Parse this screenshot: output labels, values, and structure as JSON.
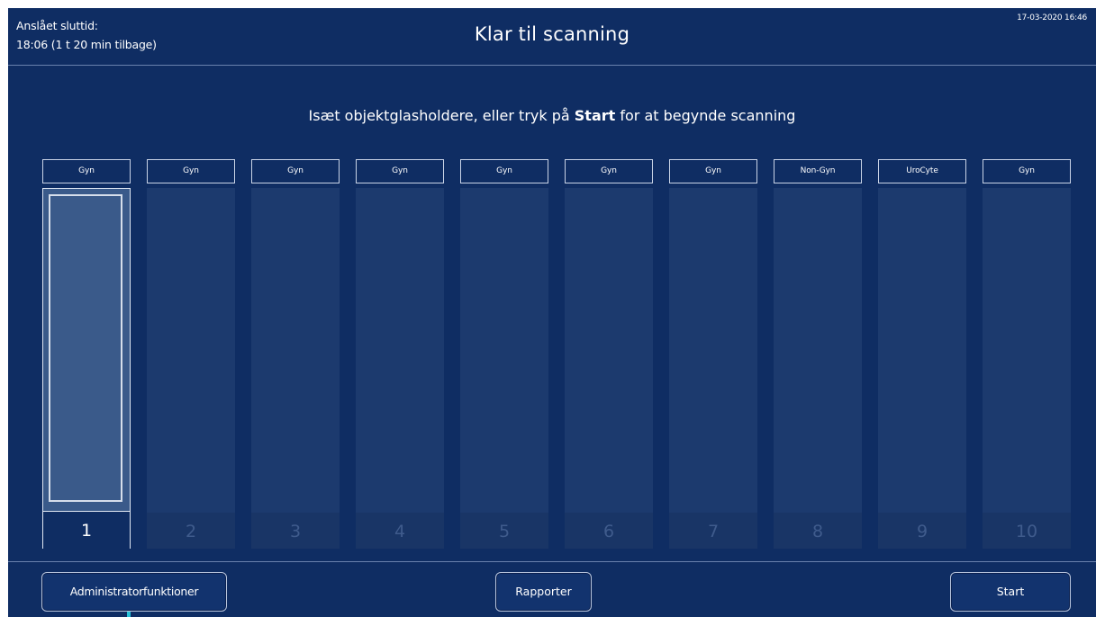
{
  "header": {
    "eta_label": "Anslået sluttid:",
    "eta_value": "18:06 (1 t 20 min tilbage)",
    "title": "Klar til scanning",
    "datetime": "17-03-2020 16:46"
  },
  "instruction": {
    "before": "Isæt objektglasholdere, eller tryk på ",
    "bold": "Start",
    "after": " for at begynde scanning"
  },
  "slots": [
    {
      "label": "Gyn",
      "number": "1",
      "loaded": true
    },
    {
      "label": "Gyn",
      "number": "2",
      "loaded": false
    },
    {
      "label": "Gyn",
      "number": "3",
      "loaded": false
    },
    {
      "label": "Gyn",
      "number": "4",
      "loaded": false
    },
    {
      "label": "Gyn",
      "number": "5",
      "loaded": false
    },
    {
      "label": "Gyn",
      "number": "6",
      "loaded": false
    },
    {
      "label": "Gyn",
      "number": "7",
      "loaded": false
    },
    {
      "label": "Non-Gyn",
      "number": "8",
      "loaded": false
    },
    {
      "label": "UroCyte",
      "number": "9",
      "loaded": false
    },
    {
      "label": "Gyn",
      "number": "10",
      "loaded": false
    }
  ],
  "footer": {
    "admin_label": "Administratorfunktioner",
    "reports_label": "Rapporter",
    "start_label": "Start"
  },
  "colors": {
    "background": "#0f2d63",
    "slot_empty": "#1c3a6e",
    "slot_loaded": "#3a5a8a",
    "cursor_accent": "#27c1d8"
  }
}
